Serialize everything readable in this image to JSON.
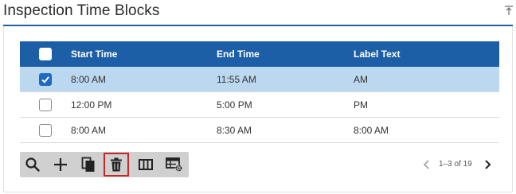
{
  "panel": {
    "title": "Inspection Time Blocks"
  },
  "table": {
    "columns": [
      "Start Time",
      "End Time",
      "Label Text"
    ],
    "rows": [
      {
        "start": "8:00 AM",
        "end": "11:55 AM",
        "label": "AM",
        "checked": true
      },
      {
        "start": "12:00 PM",
        "end": "5:00 PM",
        "label": "PM",
        "checked": false
      },
      {
        "start": "8:00 AM",
        "end": "8:30 AM",
        "label": "8:00 AM",
        "checked": false
      }
    ]
  },
  "toolbar": {
    "buttons": [
      "search-icon",
      "add-icon",
      "copy-icon",
      "delete-icon",
      "columns-icon",
      "grid-settings-icon"
    ],
    "active": "delete-icon"
  },
  "pager": {
    "info": "1–3 of 19"
  },
  "colors": {
    "header_bg": "#1d5fa6",
    "selected_row_bg": "#bcd7f0",
    "accent": "#1e5f9e",
    "toolbar_bg": "#d0d0d0",
    "active_outline": "#c62828"
  }
}
